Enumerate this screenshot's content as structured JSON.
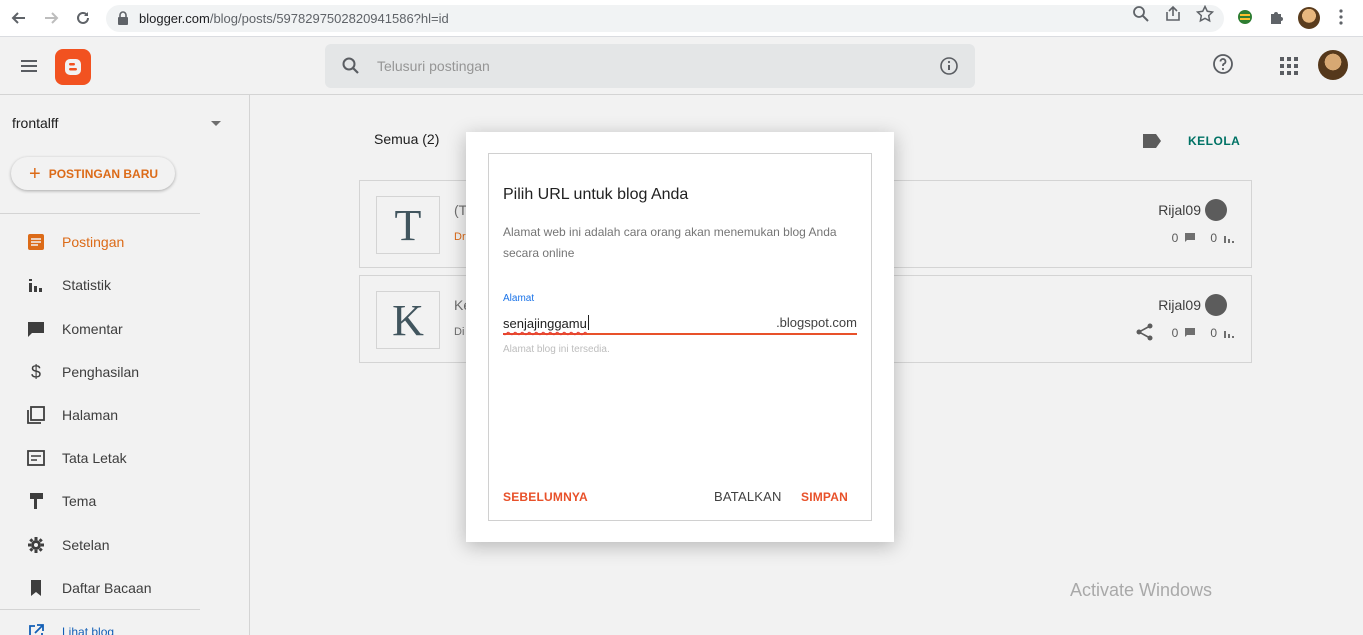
{
  "browser": {
    "url_host": "blogger.com",
    "url_path": "/blog/posts/5978297502820941586?hl=id"
  },
  "header": {
    "search_placeholder": "Telusuri postingan"
  },
  "sidebar": {
    "blog_name": "frontalff",
    "new_post_label": "POSTINGAN BARU",
    "items": [
      {
        "label": "Postingan",
        "icon": "posts-icon",
        "active": true
      },
      {
        "label": "Statistik",
        "icon": "stats-icon"
      },
      {
        "label": "Komentar",
        "icon": "comment-icon"
      },
      {
        "label": "Penghasilan",
        "icon": "dollar-icon"
      },
      {
        "label": "Halaman",
        "icon": "pages-icon"
      },
      {
        "label": "Tata Letak",
        "icon": "layout-icon"
      },
      {
        "label": "Tema",
        "icon": "theme-icon"
      },
      {
        "label": "Setelan",
        "icon": "gear-icon"
      },
      {
        "label": "Daftar Bacaan",
        "icon": "bookmark-icon"
      },
      {
        "label": "Lihat blog",
        "icon": "external-link-icon"
      }
    ]
  },
  "main": {
    "filter_label": "Semua (2)",
    "manage_label": "KELOLA",
    "posts": [
      {
        "thumb": "T",
        "title": "(T",
        "status": "Dr",
        "author": "Rijal09",
        "comments": "0",
        "views": "0"
      },
      {
        "thumb": "K",
        "title": "Ke",
        "status": "Di",
        "author": "Rijal09",
        "comments": "0",
        "views": "0"
      }
    ]
  },
  "dialog": {
    "title": "Pilih URL untuk blog Anda",
    "description": "Alamat web ini adalah cara orang akan menemukan blog Anda secara online",
    "field_label": "Alamat",
    "field_value": "senjajinggamu",
    "field_suffix": ".blogspot.com",
    "helper_text": "Alamat blog ini tersedia.",
    "prev_label": "SEBELUMNYA",
    "cancel_label": "BATALKAN",
    "save_label": "SIMPAN"
  },
  "watermark": "Activate Windows",
  "colors": {
    "accent": "#e8711a",
    "error_underline": "#e8512a",
    "brand": "#ff5722",
    "link_teal": "#00796b"
  }
}
